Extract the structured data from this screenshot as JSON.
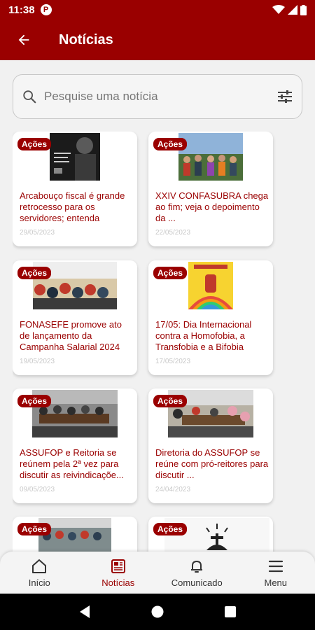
{
  "status": {
    "time": "11:38",
    "app_badge": "P"
  },
  "header": {
    "title": "Notícias"
  },
  "search": {
    "placeholder": "Pesquise uma notícia"
  },
  "cards": [
    {
      "badge": "Ações",
      "title": "Arcabouço fiscal é grande retrocesso para os servidores; entenda",
      "date": "29/05/2023"
    },
    {
      "badge": "Ações",
      "title": "XXIV CONFASUBRA chega ao fim; veja o depoimento da ...",
      "date": "22/05/2023"
    },
    {
      "badge": "Ações",
      "title": "FONASEFE promove ato de lançamento da Campanha Salarial 2024",
      "date": "19/05/2023"
    },
    {
      "badge": "Ações",
      "title": "17/05: Dia Internacional contra a Homofobia, a Transfobia e a Bifobia",
      "date": "17/05/2023"
    },
    {
      "badge": "Ações",
      "title": "ASSUFOP e Reitoria se reúnem pela 2ª vez para discutir as reivindicaçõe...",
      "date": "09/05/2023"
    },
    {
      "badge": "Ações",
      "title": "Diretoria do ASSUFOP se reúne com pró-reitores para discutir ...",
      "date": "24/04/2023"
    },
    {
      "badge": "Ações",
      "title": "",
      "date": ""
    },
    {
      "badge": "Ações",
      "title": "",
      "date": ""
    }
  ],
  "nav": {
    "inicio": "Início",
    "noticias": "Notícias",
    "comunicado": "Comunicado",
    "menu": "Menu"
  },
  "colors": {
    "primary": "#9a0000"
  }
}
